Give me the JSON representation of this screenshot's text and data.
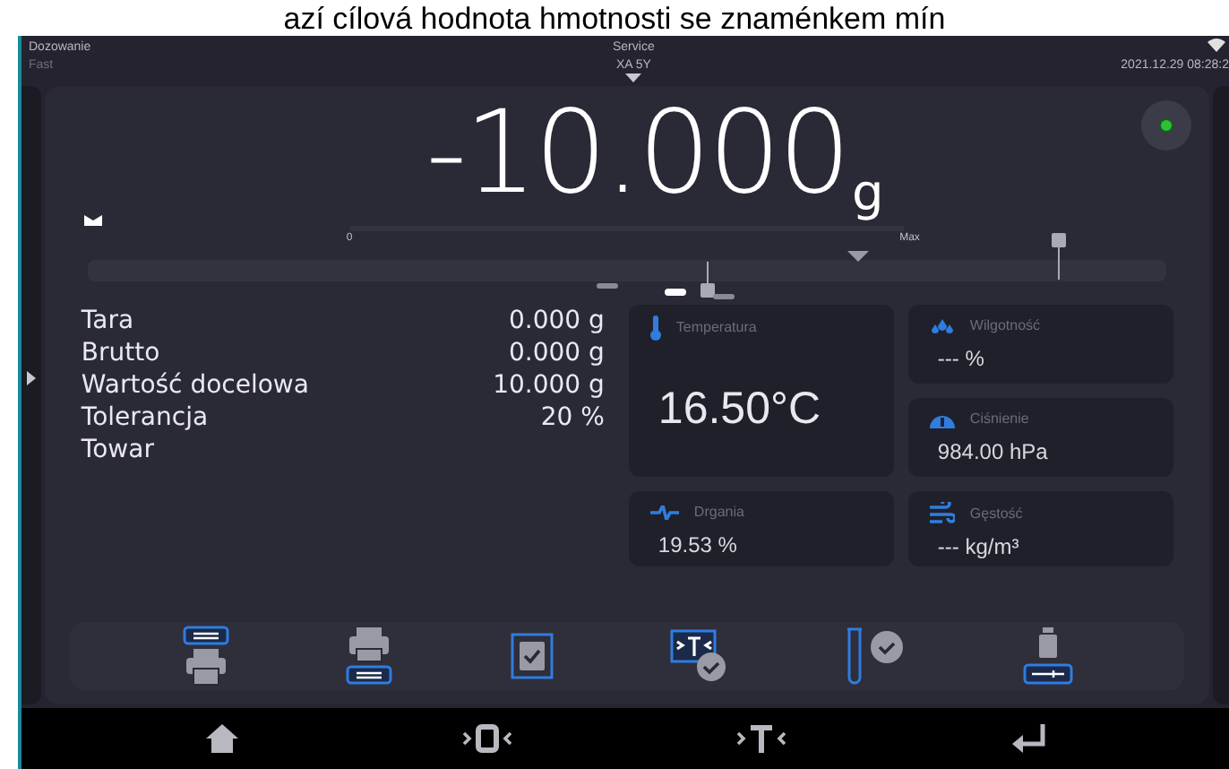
{
  "document_caption": "azí cílová hodnota hmotnosti se znaménkem mín",
  "status_bar": {
    "mode": "Dozowanie",
    "profile": "Fast",
    "user": "Service",
    "model": "XA 5Y",
    "datetime": "2021.12.29 08:28:2"
  },
  "weight": {
    "value": "-10.000",
    "unit": "g"
  },
  "bargraph": {
    "min_label": "0",
    "max_label": "Max"
  },
  "info_rows": [
    {
      "label": "Tara",
      "value": "0.000 g"
    },
    {
      "label": "Brutto",
      "value": "0.000 g"
    },
    {
      "label": "Wartość docelowa",
      "value": "10.000 g"
    },
    {
      "label": "Tolerancja",
      "value": "20 %"
    },
    {
      "label": "Towar",
      "value": ""
    }
  ],
  "sensors": [
    {
      "kind": "temperature",
      "label": "Temperatura",
      "value": "16.50°C"
    },
    {
      "kind": "humidity",
      "label": "Wilgotność",
      "value": "--- %"
    },
    {
      "kind": "pressure",
      "label": "Ciśnienie",
      "value": "984.00 hPa"
    },
    {
      "kind": "vibration",
      "label": "Drgania",
      "value": "19.53 %"
    },
    {
      "kind": "density",
      "label": "Gęstość",
      "value": "--- kg/m³"
    }
  ]
}
